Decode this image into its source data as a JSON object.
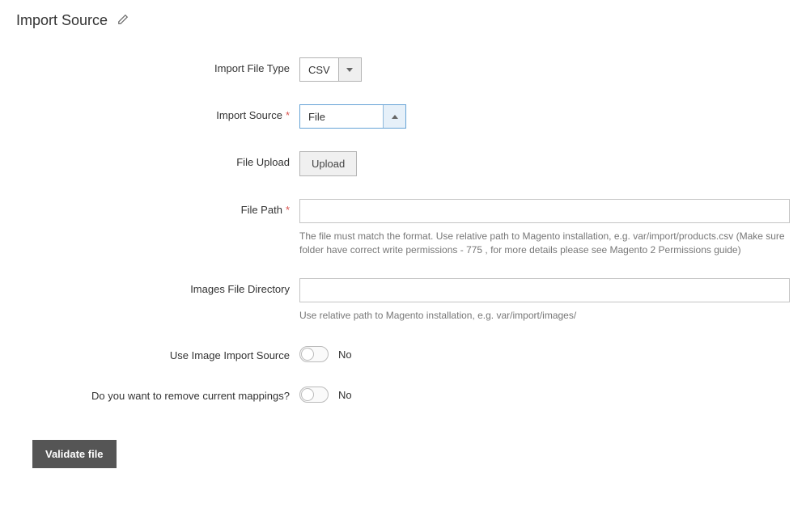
{
  "section": {
    "title": "Import Source"
  },
  "fields": {
    "file_type": {
      "label": "Import File Type",
      "value": "CSV"
    },
    "import_source": {
      "label": "Import Source",
      "value": "File"
    },
    "file_upload": {
      "label": "File Upload",
      "button": "Upload"
    },
    "file_path": {
      "label": "File Path",
      "value": "",
      "hint": "The file must match the format. Use relative path to Magento installation, e.g. var/import/products.csv (Make sure folder have correct write permissions - 775 , for more details please see Magento 2 Permissions guide)"
    },
    "images_dir": {
      "label": "Images File Directory",
      "value": "",
      "hint": "Use relative path to Magento installation, e.g. var/import/images/"
    },
    "use_image_import_source": {
      "label": "Use Image Import Source",
      "value": "No"
    },
    "remove_mappings": {
      "label": "Do you want to remove current mappings?",
      "value": "No"
    }
  },
  "actions": {
    "validate": "Validate file"
  }
}
